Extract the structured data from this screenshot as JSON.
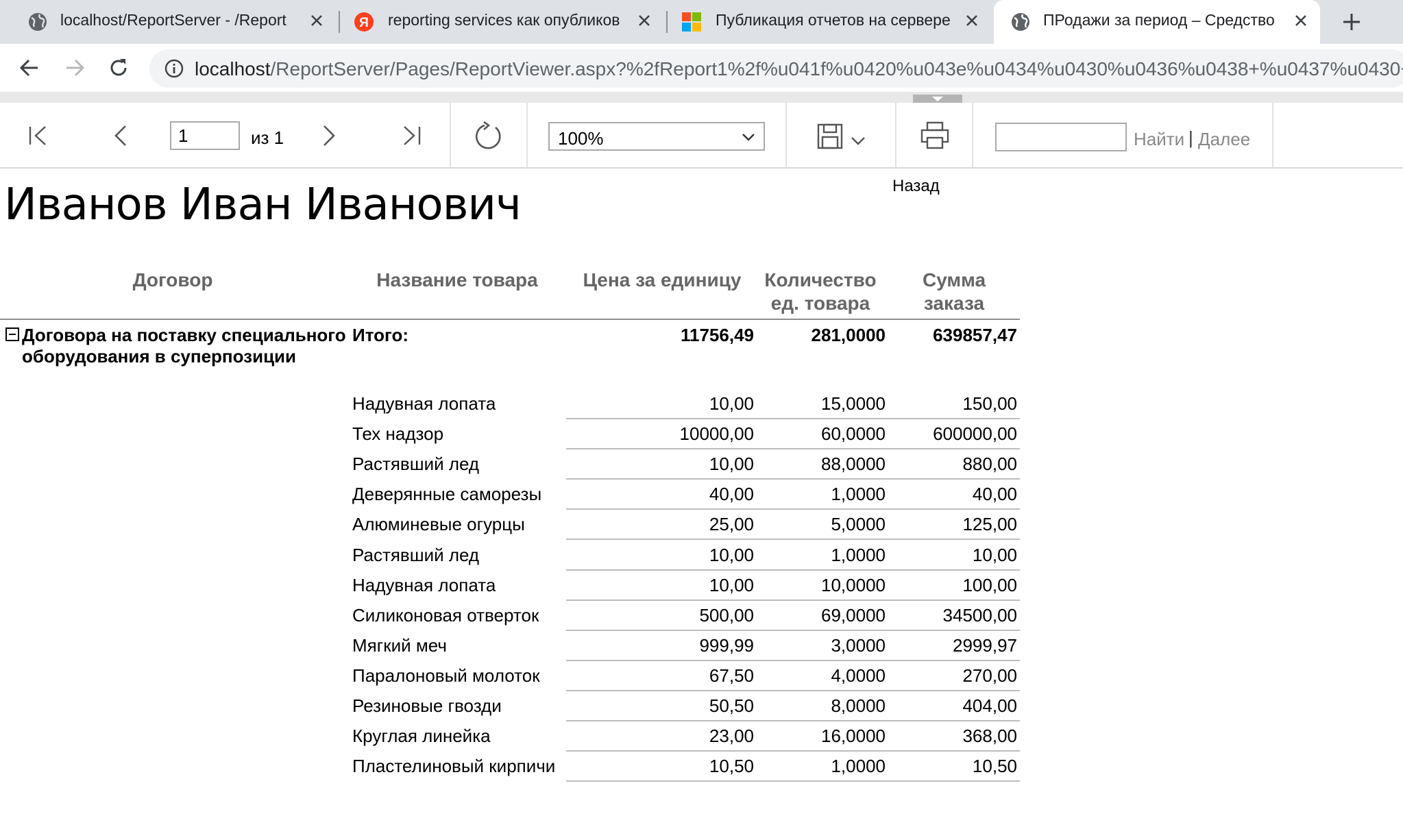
{
  "browser": {
    "tabs": [
      {
        "title": "localhost/ReportServer - /Report",
        "favicon": "globe-icon",
        "active": false
      },
      {
        "title": "reporting services как опубликов",
        "favicon": "yandex-icon",
        "active": false
      },
      {
        "title": "Публикация отчетов на сервере",
        "favicon": "microsoft-icon",
        "active": false
      },
      {
        "title": "ПРодажи за период – Средство",
        "favicon": "globe-icon",
        "active": true
      }
    ],
    "url_host": "localhost",
    "url_path": "/ReportServer/Pages/ReportViewer.aspx?%2fReport1%2f%u041f%u0420%u043e%u0434%u0430%u0436%u0438+%u0437%u0430+%u"
  },
  "toolbar": {
    "page_number": "1",
    "of_label": "из 1",
    "zoom": "100%",
    "find_placeholder": "",
    "find_label": "Найти",
    "find_separator": "|",
    "next_label": "Далее",
    "back_label": "Назад"
  },
  "report": {
    "title": "Иванов Иван Иванович",
    "headers": {
      "contract": "Договор",
      "product": "Название товара",
      "unit_price": "Цена за единицу",
      "quantity_line1": "Количество",
      "quantity_line2": "ед. товара",
      "sum_line1": "Сумма",
      "sum_line2": "заказа"
    },
    "group": {
      "label": "Договора на поставку специального оборудования в суперпозиции",
      "total_label": "Итого:",
      "total_price": "11756,49",
      "total_quantity": "281,0000",
      "total_sum": "639857,47"
    },
    "rows": [
      {
        "product": "Надувная лопата",
        "price": "10,00",
        "quantity": "15,0000",
        "sum": "150,00"
      },
      {
        "product": "Тех надзор",
        "price": "10000,00",
        "quantity": "60,0000",
        "sum": "600000,00"
      },
      {
        "product": "Растявший лед",
        "price": "10,00",
        "quantity": "88,0000",
        "sum": "880,00"
      },
      {
        "product": "Деверянные саморезы",
        "price": "40,00",
        "quantity": "1,0000",
        "sum": "40,00"
      },
      {
        "product": "Алюминевые огурцы",
        "price": "25,00",
        "quantity": "5,0000",
        "sum": "125,00"
      },
      {
        "product": "Растявший лед",
        "price": "10,00",
        "quantity": "1,0000",
        "sum": "10,00"
      },
      {
        "product": "Надувная лопата",
        "price": "10,00",
        "quantity": "10,0000",
        "sum": "100,00"
      },
      {
        "product": "Силиконовая отверток",
        "price": "500,00",
        "quantity": "69,0000",
        "sum": "34500,00"
      },
      {
        "product": "Мягкий меч",
        "price": "999,99",
        "quantity": "3,0000",
        "sum": "2999,97"
      },
      {
        "product": "Паралоновый молоток",
        "price": "67,50",
        "quantity": "4,0000",
        "sum": "270,00"
      },
      {
        "product": "Резиновые гвозди",
        "price": "50,50",
        "quantity": "8,0000",
        "sum": "404,00"
      },
      {
        "product": "Круглая линейка",
        "price": "23,00",
        "quantity": "16,0000",
        "sum": "368,00"
      },
      {
        "product": "Пластелиновый кирпичи",
        "price": "10,50",
        "quantity": "1,0000",
        "sum": "10,50"
      }
    ]
  }
}
